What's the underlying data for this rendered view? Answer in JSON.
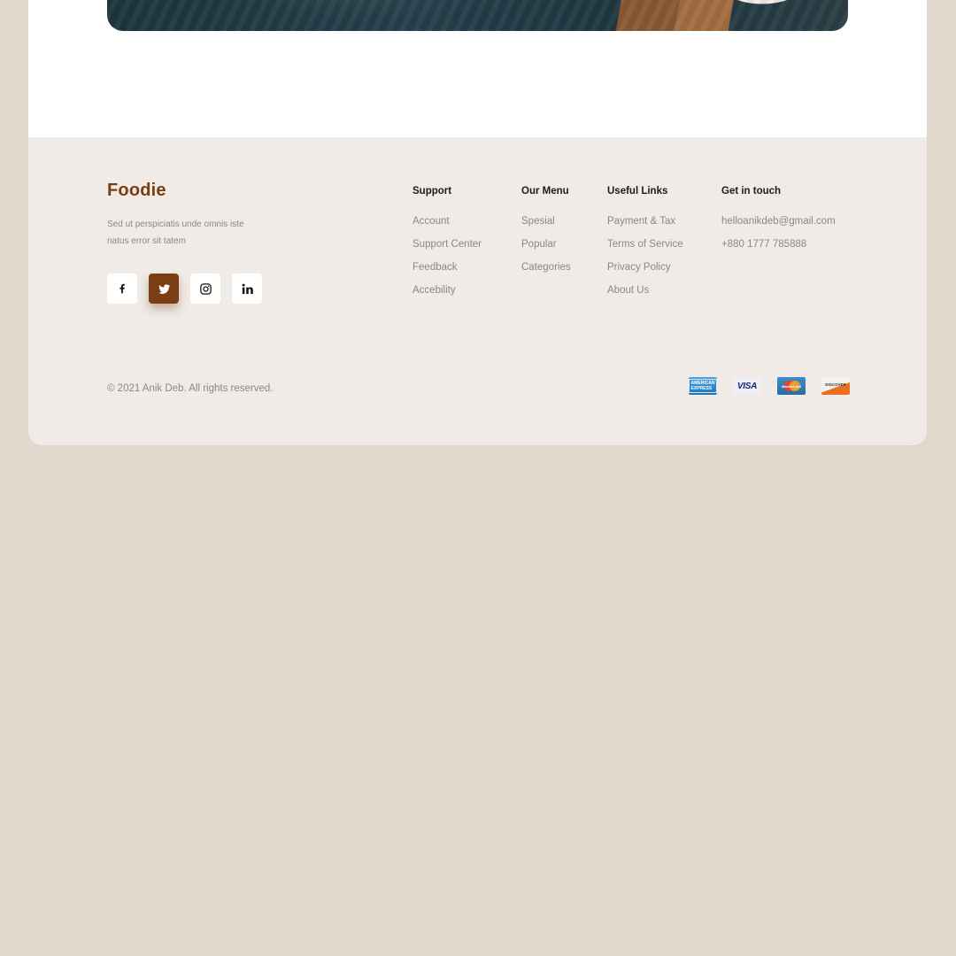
{
  "brand": {
    "name": "Foodie",
    "description": "Sed ut perspiciatis unde omnis iste natus error sit tatem"
  },
  "socials": [
    {
      "icon": "facebook-icon",
      "label": "f",
      "active": false
    },
    {
      "icon": "twitter-icon",
      "active": true
    },
    {
      "icon": "instagram-icon",
      "active": false
    },
    {
      "icon": "linkedin-icon",
      "label": "in",
      "active": false
    }
  ],
  "columns": {
    "support": {
      "title": "Support",
      "items": [
        "Account",
        "Support Center",
        "Feedback",
        "Accebility"
      ]
    },
    "menu": {
      "title": "Our Menu",
      "items": [
        "Spesial",
        "Popular",
        "Categories"
      ]
    },
    "links": {
      "title": "Useful Links",
      "items": [
        "Payment & Tax",
        "Terms of Service",
        "Privacy Policy",
        "About Us"
      ]
    },
    "contact": {
      "title": "Get in touch",
      "items": [
        "helloanikdeb@gmail.com",
        "+880 1777 785888"
      ]
    }
  },
  "copyright": "© 2021 Anik Deb. All rights reserved.",
  "payments": [
    {
      "icon": "amex-card-icon",
      "label": "AMERICAN EXPRESS"
    },
    {
      "icon": "visa-card-icon",
      "label": "VISA"
    },
    {
      "icon": "mastercard-card-icon",
      "label": "MasterCard"
    },
    {
      "icon": "discover-card-icon",
      "label": "DISCOVER"
    }
  ],
  "colors": {
    "brand": "#7a3e12",
    "page_background": "#e0d7cd",
    "footer_background": "#f0ebe6",
    "muted_text": "#8d8782"
  }
}
